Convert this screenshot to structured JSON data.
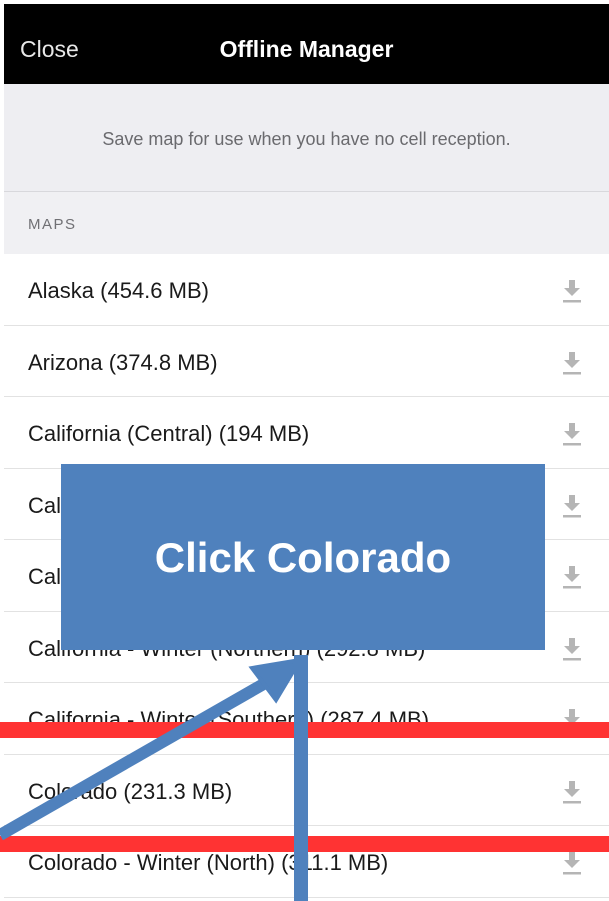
{
  "header": {
    "close_label": "Close",
    "title": "Offline Manager"
  },
  "banner": {
    "text": "Save map for use when you have no cell reception."
  },
  "section": {
    "label": "MAPS"
  },
  "maps": [
    {
      "label": "Alaska (454.6 MB)"
    },
    {
      "label": "Arizona (374.8 MB)"
    },
    {
      "label": "California (Central) (194 MB)"
    },
    {
      "label": "Cal"
    },
    {
      "label": "Cal"
    },
    {
      "label": "California - Winter (Northern) (292.8 MB)"
    },
    {
      "label": "California - Winter (Southern) (287.4 MB)"
    },
    {
      "label": "Colorado (231.3 MB)"
    },
    {
      "label": "Colorado - Winter (North) (311.1 MB)"
    }
  ],
  "annotation": {
    "text": "Click Colorado",
    "box_color": "#4f81bd",
    "highlight_color": "#ff3333"
  },
  "icons": {
    "download": "download-icon"
  }
}
